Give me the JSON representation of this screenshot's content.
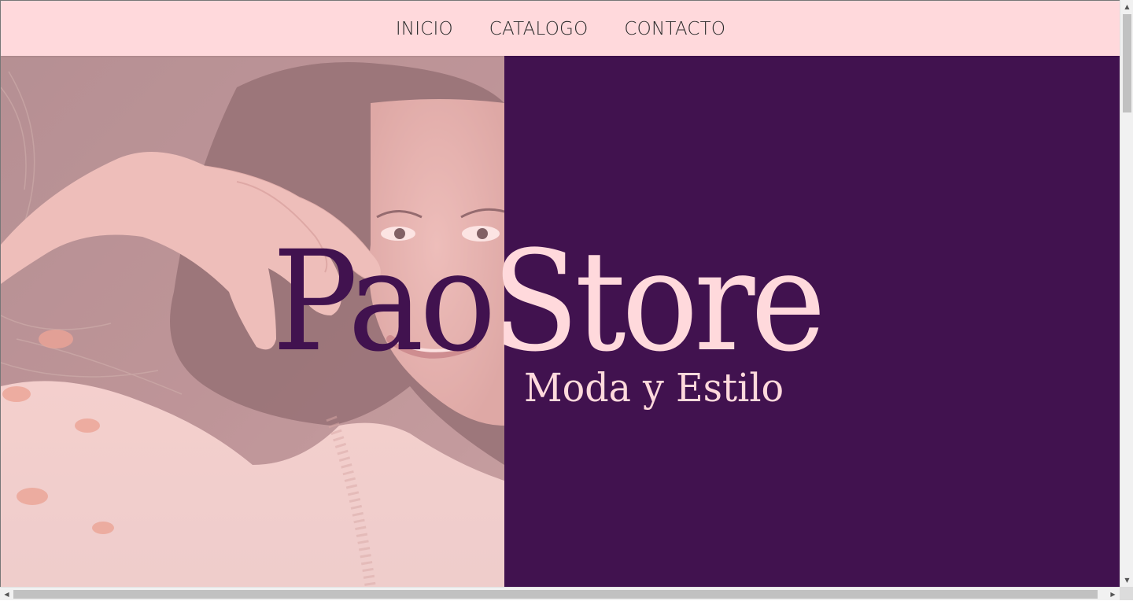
{
  "nav": {
    "items": [
      {
        "label": "INICIO"
      },
      {
        "label": "CATALOGO"
      },
      {
        "label": "CONTACTO"
      }
    ]
  },
  "hero": {
    "title_part_a": "Pao",
    "title_part_b": "Store",
    "subtitle": "Moda y Estilo",
    "image_subject": "portrait of a smiling young woman resting her hand near her face, pink tinted overlay"
  },
  "colors": {
    "nav_bg": "#ffd9dc",
    "accent_purple": "#41124f",
    "accent_pink": "#ffd9dc",
    "nav_text": "#2b2b2b"
  },
  "scrollbars": {
    "up_arrow": "▲",
    "down_arrow": "▼",
    "left_arrow": "◀",
    "right_arrow": "▶"
  }
}
